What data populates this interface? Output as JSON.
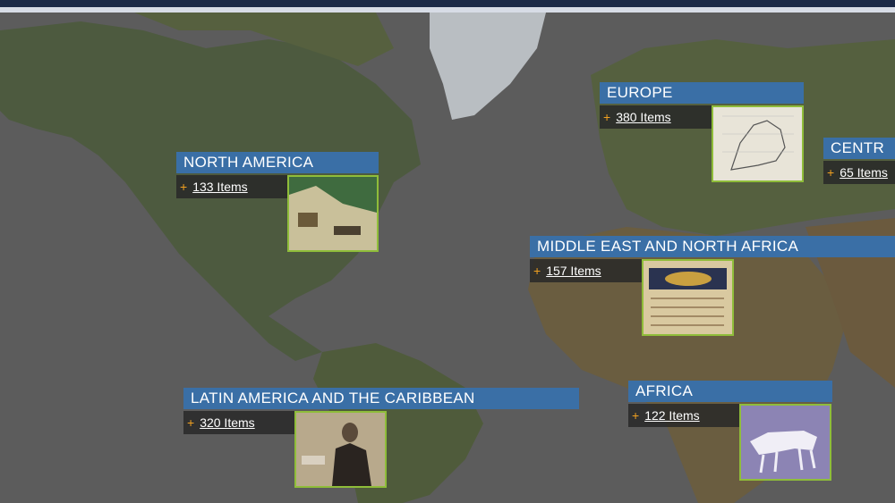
{
  "header": {
    "bar_color": "#1c2a47"
  },
  "colors": {
    "title_bg": "#3a6fa6",
    "plus": "#f0a020",
    "thumb_border": "#8fbd3a",
    "ocean": "#5c5c5c"
  },
  "regions": [
    {
      "name": "NORTH AMERICA",
      "count": "133 Items",
      "thumb_icon": "landscape-sketch-icon"
    },
    {
      "name": "EUROPE",
      "count": "380 Items",
      "thumb_icon": "old-map-icon"
    },
    {
      "name": "CENTR",
      "count": "65 Items",
      "thumb_icon": ""
    },
    {
      "name": "MIDDLE EAST AND NORTH AFRICA",
      "count": "157 Items",
      "thumb_icon": "manuscript-icon"
    },
    {
      "name": "LATIN AMERICA AND THE CARIBBEAN",
      "count": "320 Items",
      "thumb_icon": "portrait-photo-icon"
    },
    {
      "name": "AFRICA",
      "count": "122 Items",
      "thumb_icon": "rock-painting-icon"
    }
  ]
}
